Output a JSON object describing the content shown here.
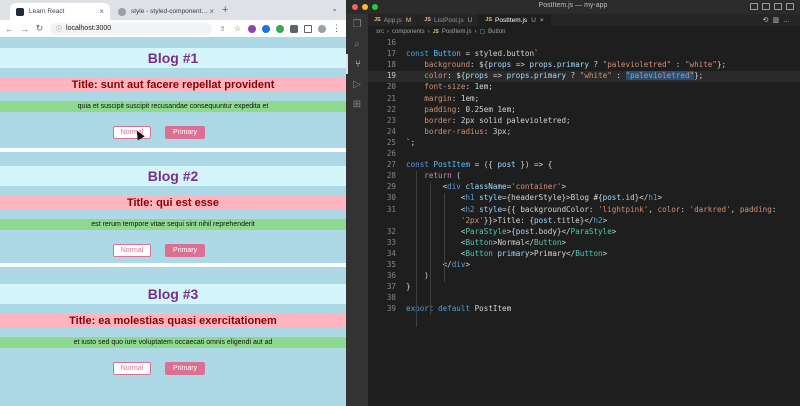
{
  "browser": {
    "tabs": [
      {
        "label": "Learn React",
        "active": true
      },
      {
        "label": "style - styled-components: Basics",
        "active": false
      }
    ],
    "url": "localhost:3000"
  },
  "posts": [
    {
      "heading": "Blog #1",
      "title": "Title: sunt aut facere repellat provident",
      "body": "quia et suscipit suscipit recusandae consequuntur expedita et",
      "normal_label": "Normal",
      "primary_label": "Primary"
    },
    {
      "heading": "Blog #2",
      "title": "Title: qui est esse",
      "body": "est rerum tempore vitae sequi sint nihil reprehenderit",
      "normal_label": "Normal",
      "primary_label": "Primary"
    },
    {
      "heading": "Blog #3",
      "title": "Title: ea molestias quasi exercitationem",
      "body": "et iusto sed quo iure voluptatem occaecati omnis eligendi aut ad",
      "normal_label": "Normal",
      "primary_label": "Primary"
    }
  ],
  "editor": {
    "window_title": "PostItem.js — my-app",
    "tabs": [
      {
        "label": "App.js",
        "badge": "M"
      },
      {
        "label": "ListPost.js",
        "badge": "U"
      },
      {
        "label": "PostItem.js",
        "badge": "U",
        "active": true
      }
    ],
    "breadcrumb": [
      "src",
      "components",
      "PostItem.js",
      "Button"
    ],
    "lines": [
      {
        "n": "16",
        "t": ""
      },
      {
        "n": "17",
        "t": "const Button = styled.button`"
      },
      {
        "n": "18",
        "t": "    background: ${props => props.primary ? \"palevioletred\" : \"white\"};"
      },
      {
        "n": "19",
        "t": "    color: ${props => props.primary ? \"white\" : \"palevioletred\"};"
      },
      {
        "n": "20",
        "t": "    font-size: 1em;"
      },
      {
        "n": "21",
        "t": "    margin: 1em;"
      },
      {
        "n": "22",
        "t": "    padding: 0.25em 1em;"
      },
      {
        "n": "23",
        "t": "    border: 2px solid palevioletred;"
      },
      {
        "n": "24",
        "t": "    border-radius: 3px;"
      },
      {
        "n": "25",
        "t": "`;"
      },
      {
        "n": "26",
        "t": ""
      },
      {
        "n": "27",
        "t": "const PostItem = ({ post }) => {"
      },
      {
        "n": "28",
        "t": "    return ("
      },
      {
        "n": "29",
        "t": "        <div className='container'>"
      },
      {
        "n": "30",
        "t": "            <h1 style={headerStyle}>Blog #{post.id}</h1>"
      },
      {
        "n": "31",
        "t": "            <h2 style={{ backgroundColor: 'lightpink', color: 'darkred', padding:"
      },
      {
        "n": "",
        "t": "            '2px'}}>Title: {post.title}</h2>"
      },
      {
        "n": "32",
        "t": "            <ParaStyle>{post.body}</ParaStyle>"
      },
      {
        "n": "33",
        "t": "            <Button>Normal</Button>"
      },
      {
        "n": "34",
        "t": "            <Button primary>Primary</Button>"
      },
      {
        "n": "35",
        "t": "        </div>"
      },
      {
        "n": "36",
        "t": "    )"
      },
      {
        "n": "37",
        "t": "}"
      },
      {
        "n": "38",
        "t": ""
      },
      {
        "n": "39",
        "t": "export default PostItem"
      }
    ]
  },
  "colors": {
    "container_bg": "#add8e6",
    "heading_bg": "#d4f6fb",
    "heading_text": "#7b2d8b",
    "title_bg": "#ffb6c1",
    "title_text": "#8b0000",
    "body_bg": "#8fd98f",
    "button_accent": "#db7093"
  }
}
